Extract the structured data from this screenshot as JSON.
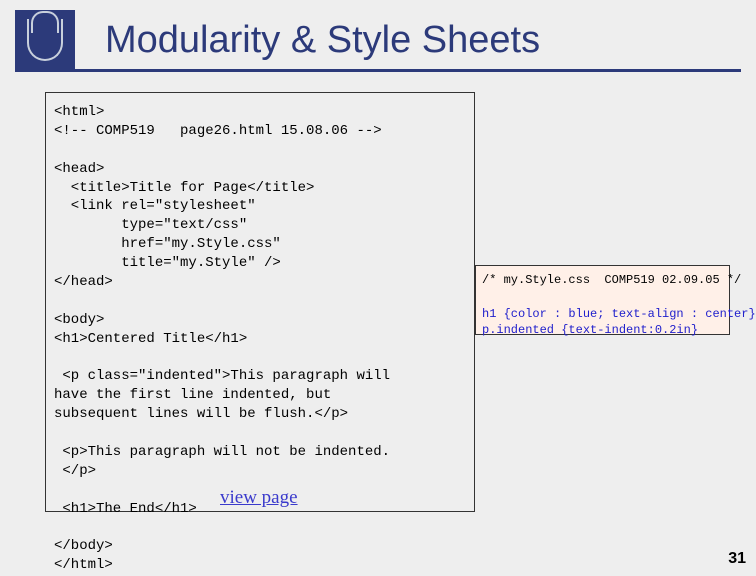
{
  "header": {
    "title": "Modularity & Style Sheets"
  },
  "codebox": {
    "line1": "<html>",
    "line2": "<!-- COMP519   page26.html 15.08.06 -->",
    "line3": "",
    "line4": "<head>",
    "line5": "  <title>Title for Page</title>",
    "line6": "  <link rel=\"stylesheet\"",
    "line7": "        type=\"text/css\"",
    "line8": "        href=\"my.Style.css\"",
    "line9": "        title=\"my.Style\" />",
    "line10": "</head>",
    "line11": "",
    "line12": "<body>",
    "line13": "<h1>Centered Title</h1>",
    "line14": "",
    "line15": " <p class=\"indented\">This paragraph will",
    "line16": "have the first line indented, but",
    "line17": "subsequent lines will be flush.</p>",
    "line18": "",
    "line19": " <p>This paragraph will not be indented.",
    "line20": " </p>",
    "line21": "",
    "line22": " <h1>The End</h1>",
    "line23": "",
    "line24": "</body>",
    "line25": "</html>"
  },
  "cssbox": {
    "comment": "/* my.Style.css  COMP519 02.09.05 */",
    "rule1": "h1 {color : blue; text-align : center}",
    "rule2": "p.indented {text-indent:0.2in}"
  },
  "link": {
    "label": "view page"
  },
  "footer": {
    "pagenum": "31"
  }
}
